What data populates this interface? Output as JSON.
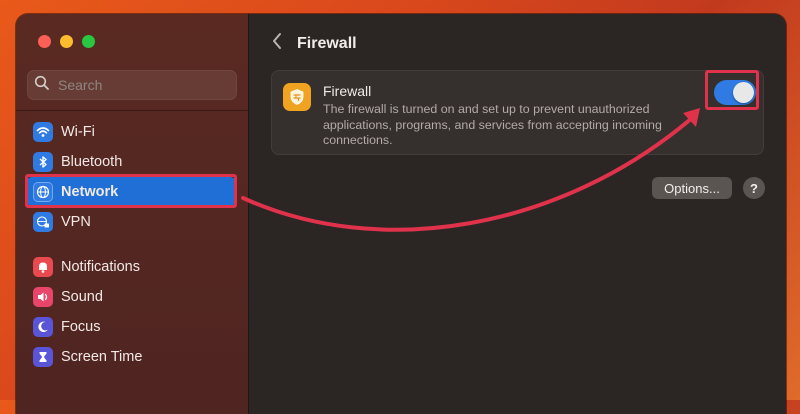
{
  "window": {
    "traffic_lights": [
      "close",
      "minimize",
      "zoom"
    ]
  },
  "sidebar": {
    "search_placeholder": "Search",
    "items": [
      {
        "label": "Wi-Fi",
        "icon": "wifi-icon",
        "color": "#2f7be3"
      },
      {
        "label": "Bluetooth",
        "icon": "bluetooth-icon",
        "color": "#2f7be3"
      },
      {
        "label": "Network",
        "icon": "globe-icon",
        "color": "#2f7be3",
        "selected": true
      },
      {
        "label": "VPN",
        "icon": "globe-lock-icon",
        "color": "#2f7be3"
      },
      {
        "label": "Notifications",
        "icon": "bell-icon",
        "color": "#e84a4f"
      },
      {
        "label": "Sound",
        "icon": "speaker-icon",
        "color": "#e8456a"
      },
      {
        "label": "Focus",
        "icon": "moon-icon",
        "color": "#5a55d6"
      },
      {
        "label": "Screen Time",
        "icon": "hourglass-icon",
        "color": "#5a55d6"
      }
    ]
  },
  "main": {
    "title": "Firewall",
    "card": {
      "title": "Firewall",
      "description": "The firewall is turned on and set up to prevent unauthorized applications, programs, and services from accepting incoming connections.",
      "toggle_on": true,
      "icon": "firewall-shield-icon"
    },
    "options_label": "Options...",
    "help_label": "?"
  },
  "colors": {
    "accent": "#1f6fd6",
    "annotation": "#e0324b",
    "firewall_icon": "#f0a321"
  }
}
